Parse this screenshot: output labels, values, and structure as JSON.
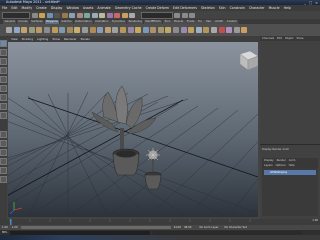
{
  "app": {
    "title": "Autodesk Maya 2011 - untitled*",
    "window_buttons": [
      "_",
      "□",
      "×"
    ]
  },
  "menu": [
    "File",
    "Edit",
    "Modify",
    "Create",
    "Display",
    "Window",
    "Assets",
    "Animate",
    "Geometry Cache",
    "Create Deform",
    "Edit Deformers",
    "Skeleton",
    "Skin",
    "Constrain",
    "Character",
    "Muscle",
    "Help"
  ],
  "shelf_tabs": [
    {
      "label": "General",
      "active": false
    },
    {
      "label": "Curves",
      "active": false
    },
    {
      "label": "Surfaces",
      "active": false
    },
    {
      "label": "Polygons",
      "active": true
    },
    {
      "label": "Subdivs",
      "active": false
    },
    {
      "label": "Deformation",
      "active": false
    },
    {
      "label": "Animation",
      "active": false
    },
    {
      "label": "Dynamics",
      "active": false
    },
    {
      "label": "Rendering",
      "active": false
    },
    {
      "label": "PaintEffects",
      "active": false
    },
    {
      "label": "Toon",
      "active": false
    },
    {
      "label": "Muscle",
      "active": false
    },
    {
      "label": "Fluids",
      "active": false
    },
    {
      "label": "Fur",
      "active": false
    },
    {
      "label": "Hair",
      "active": false
    },
    {
      "label": "nCloth",
      "active": false
    },
    {
      "label": "Custom",
      "active": false
    }
  ],
  "viewport_menu": [
    "View",
    "Shading",
    "Lighting",
    "Show",
    "Renderer",
    "Panels"
  ],
  "channel_box": {
    "tabs": [
      "Channels",
      "Edit",
      "Object",
      "Show"
    ],
    "layer_label": "Display Render Anim",
    "layer_tabs": [
      "Display",
      "Render",
      "Anim"
    ],
    "layer_menus": [
      "Layers",
      "Options",
      "Help"
    ],
    "layer_name": "AllHatsDisplay"
  },
  "time_slider": {
    "start": "1.00",
    "end": "24.00"
  },
  "range_slider": {
    "start": "1.00",
    "inner_start": "1.00",
    "inner_end": "24.00",
    "end": "48.00",
    "anim_layer": "No Anim Layer",
    "character": "No Character Set"
  },
  "command_line": {
    "lang": "MEL"
  }
}
